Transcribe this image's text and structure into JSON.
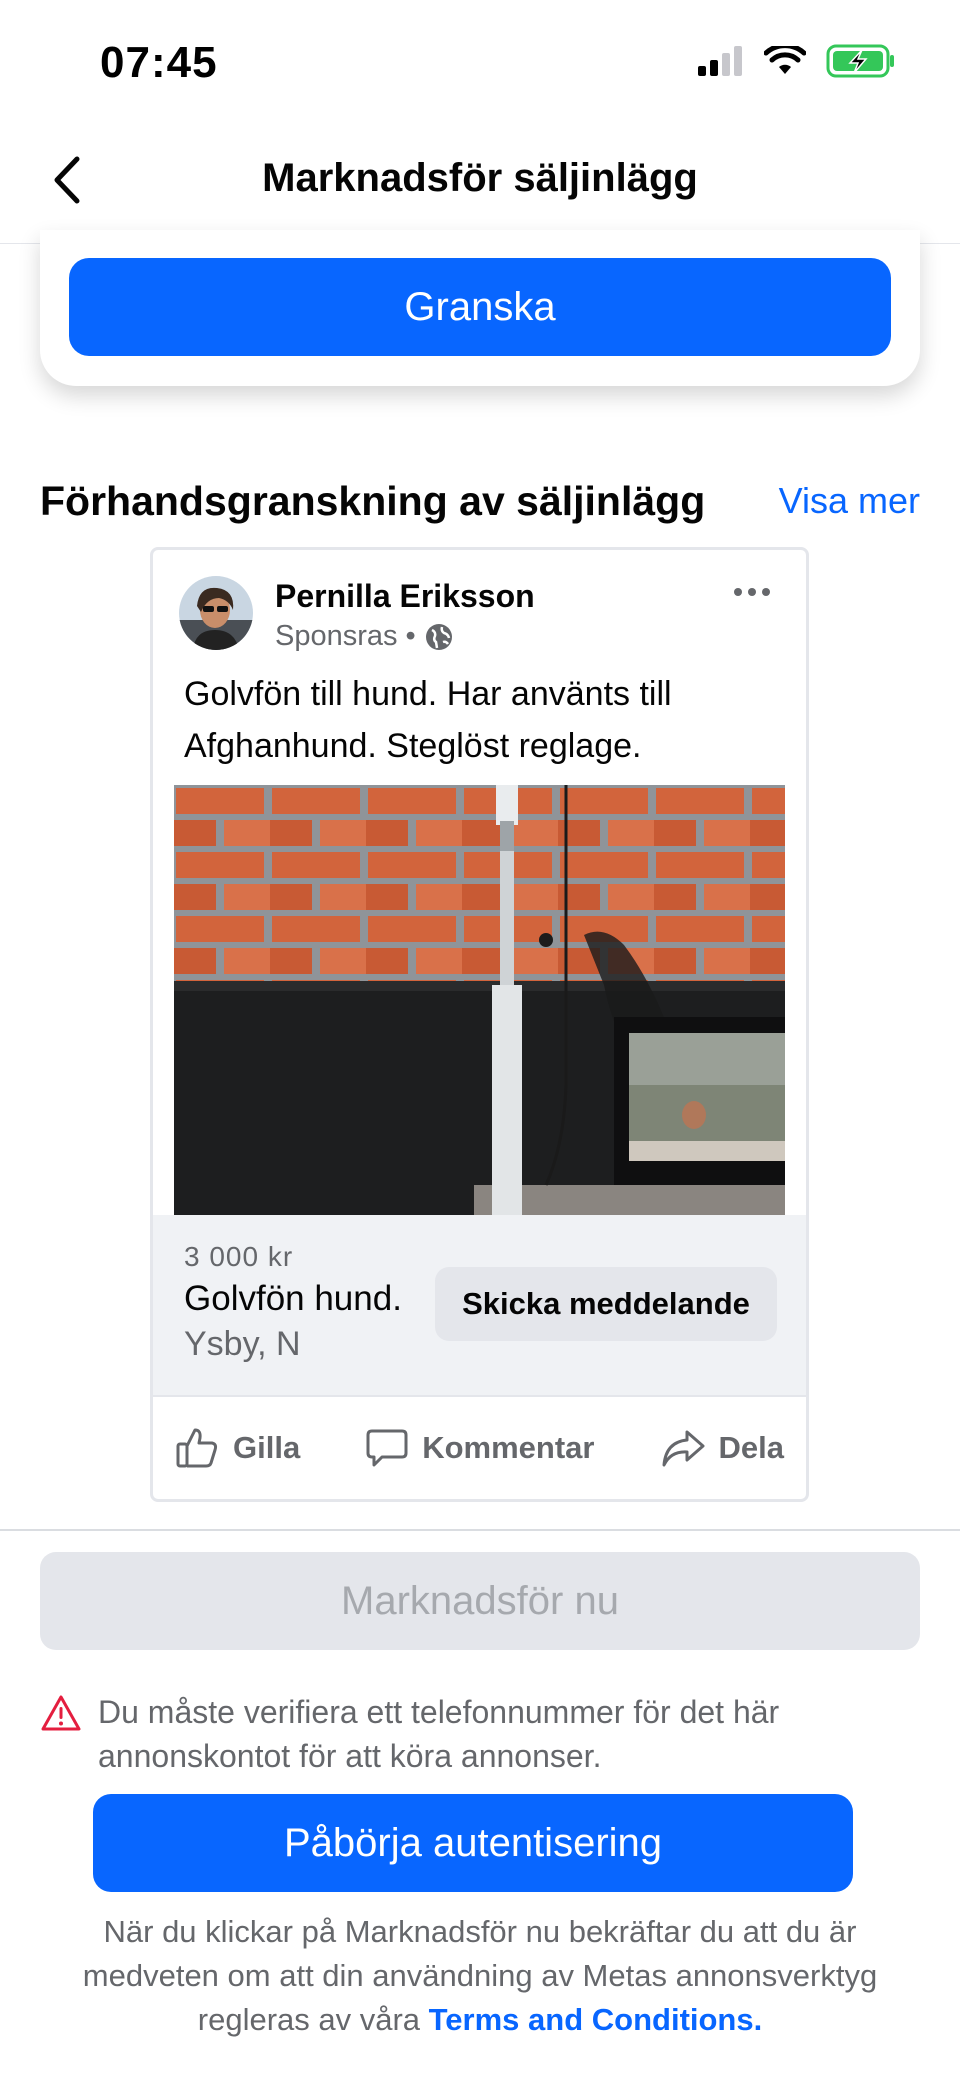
{
  "status_bar": {
    "time": "07:45",
    "icons": [
      "signal-icon",
      "wifi-icon",
      "battery-charging-icon"
    ]
  },
  "nav": {
    "title": "Marknadsför säljinlägg",
    "back_icon": "chevron-left-icon"
  },
  "review": {
    "button_label": "Granska"
  },
  "preview": {
    "section_title": "Förhandsgranskning av säljinlägg",
    "see_more": "Visa mer",
    "post": {
      "author": "Pernilla Eriksson",
      "sponsored": "Sponsras",
      "separator": "•",
      "audience_icon": "globe-icon",
      "more_icon": "more-horizontal-icon",
      "text": "Golvfön till hund. Har använts till Afghanhund. Steglöst reglage.",
      "listing": {
        "price": "3 000 kr",
        "title": "Golvfön hund.",
        "location": "Ysby, N",
        "message_button": "Skicka meddelande"
      },
      "actions": {
        "like": "Gilla",
        "comment": "Kommentar",
        "share": "Dela"
      }
    }
  },
  "promote": {
    "button_label": "Marknadsför nu"
  },
  "warning": {
    "icon": "warning-triangle-icon",
    "text": "Du måste verifiera ett telefonnummer för det här annonskontot för att köra annonser."
  },
  "auth": {
    "button_label": "Påbörja autentisering"
  },
  "legal": {
    "text": "När du klickar på Marknadsför nu bekräftar du att du är medveten om att din användning av Metas annonsverktyg regleras av våra",
    "link": "Terms and Conditions."
  },
  "colors": {
    "accent": "#0866ff",
    "disabled_bg": "#e4e6eb",
    "disabled_text": "#a6a9ae",
    "warning": "#e41e3f",
    "battery": "#34c759"
  }
}
